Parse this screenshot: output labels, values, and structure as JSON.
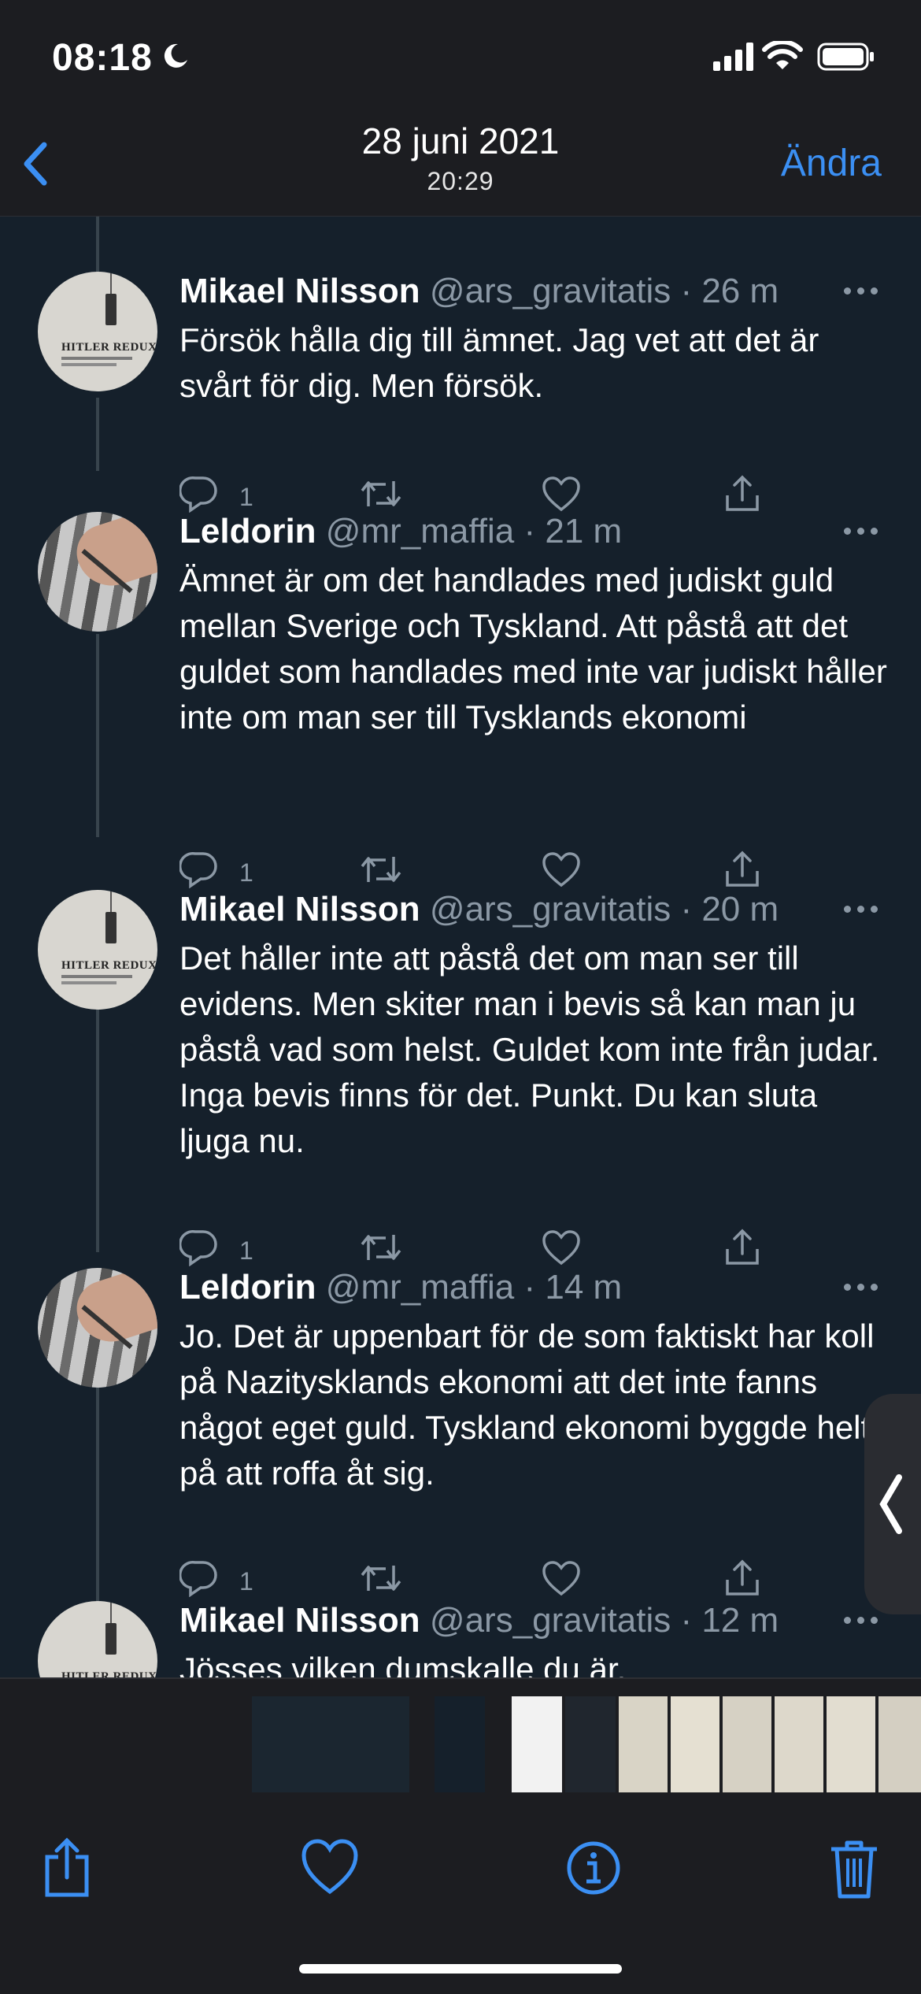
{
  "status_bar": {
    "time": "08:18"
  },
  "nav": {
    "date": "28 juni 2021",
    "time": "20:29",
    "edit_label": "Ändra"
  },
  "tweets": [
    {
      "author": "Mikael Nilsson",
      "meta": "@ars_gravitatis · 26 m",
      "text": "Försök hålla dig till ämnet. Jag vet att det är svårt för dig. Men försök.",
      "reply_count": "1",
      "avatar": "book-cover",
      "avatar_title": "HITLER REDUX"
    },
    {
      "author": "Leldorin",
      "meta": "@mr_maffia · 21 m",
      "text": "Ämnet är om det handlades med judiskt guld mellan Sverige och Tyskland. Att påstå att det guldet som handlades med inte var judiskt håller inte om man ser till Tysklands ekonomi",
      "reply_count": "1",
      "avatar": "arm-photo"
    },
    {
      "author": "Mikael Nilsson",
      "meta": "@ars_gravitatis · 20 m",
      "text": "Det håller inte att påstå det om man ser till evidens. Men skiter man i bevis så kan man ju påstå vad som helst. Guldet kom inte från judar. Inga bevis finns för det. Punkt. Du kan sluta ljuga nu.",
      "reply_count": "1",
      "avatar": "book-cover",
      "avatar_title": "HITLER REDUX"
    },
    {
      "author": "Leldorin",
      "meta": "@mr_maffia · 14 m",
      "text": "Jo. Det är uppenbart för de som faktiskt har koll på Nazitysklands ekonomi att det inte fanns något eget guld. Tyskland ekonomi byggde helt på att roffa åt sig.",
      "reply_count": "1",
      "avatar": "arm-photo"
    },
    {
      "author": "Mikael Nilsson",
      "meta": "@ars_gravitatis · 12 m",
      "text": "Jösses vilken dumskalle du är.",
      "reply_count": "",
      "avatar": "book-cover",
      "avatar_title": "HITLER REDUX"
    }
  ],
  "icons": {
    "reply": "reply-icon",
    "retweet": "retweet-icon",
    "like": "heart-icon",
    "share": "share-icon",
    "toolbar": [
      "share-icon",
      "heart-icon",
      "info-icon",
      "trash-icon"
    ]
  },
  "colors": {
    "accent": "#3b8ff3",
    "tweet_bg": "#15202b",
    "meta": "#8b98a5",
    "bars": "#1c1d21"
  }
}
